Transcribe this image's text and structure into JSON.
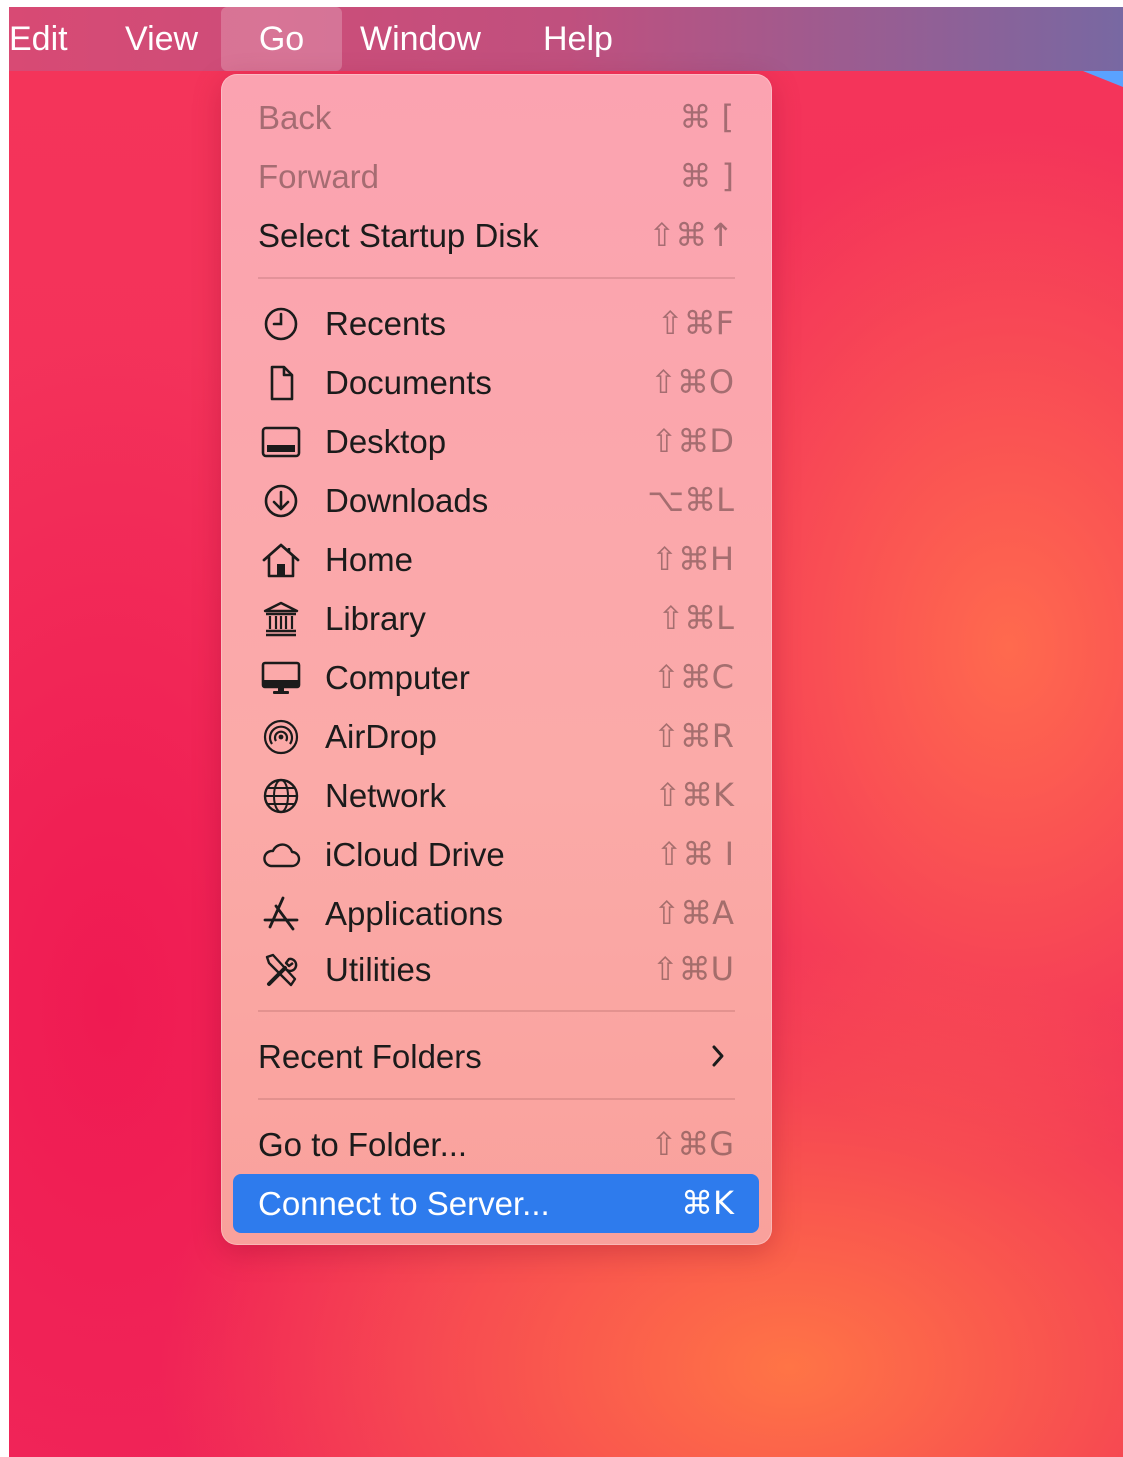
{
  "menubar": {
    "items": [
      {
        "label": "Edit"
      },
      {
        "label": "View"
      },
      {
        "label": "Go",
        "active": true
      },
      {
        "label": "Window"
      },
      {
        "label": "Help"
      }
    ]
  },
  "go_menu": {
    "back": {
      "label": "Back",
      "shortcut": "⌘ [",
      "enabled": false
    },
    "forward": {
      "label": "Forward",
      "shortcut": "⌘ ]",
      "enabled": false
    },
    "startup_disk": {
      "label": "Select Startup Disk",
      "shortcut": "⇧⌘↑"
    },
    "places": [
      {
        "label": "Recents",
        "shortcut": "⇧⌘F",
        "icon": "clock-icon"
      },
      {
        "label": "Documents",
        "shortcut": "⇧⌘O",
        "icon": "document-icon"
      },
      {
        "label": "Desktop",
        "shortcut": "⇧⌘D",
        "icon": "desktop-icon"
      },
      {
        "label": "Downloads",
        "shortcut": "⌥⌘L",
        "icon": "download-icon"
      },
      {
        "label": "Home",
        "shortcut": "⇧⌘H",
        "icon": "house-icon"
      },
      {
        "label": "Library",
        "shortcut": "⇧⌘L",
        "icon": "building-columns-icon"
      },
      {
        "label": "Computer",
        "shortcut": "⇧⌘C",
        "icon": "monitor-icon"
      },
      {
        "label": "AirDrop",
        "shortcut": "⇧⌘R",
        "icon": "airdrop-icon"
      },
      {
        "label": "Network",
        "shortcut": "⇧⌘K",
        "icon": "globe-icon"
      },
      {
        "label": "iCloud Drive",
        "shortcut": "⇧⌘ I",
        "icon": "cloud-icon"
      },
      {
        "label": "Applications",
        "shortcut": "⇧⌘A",
        "icon": "app-store-icon"
      },
      {
        "label": "Utilities",
        "shortcut": "⇧⌘U",
        "icon": "tools-icon"
      }
    ],
    "recent_folders": {
      "label": "Recent Folders"
    },
    "go_to_folder": {
      "label": "Go to Folder...",
      "shortcut": "⇧⌘G"
    },
    "connect_to_server": {
      "label": "Connect to Server...",
      "shortcut": "⌘K",
      "highlighted": true
    }
  }
}
